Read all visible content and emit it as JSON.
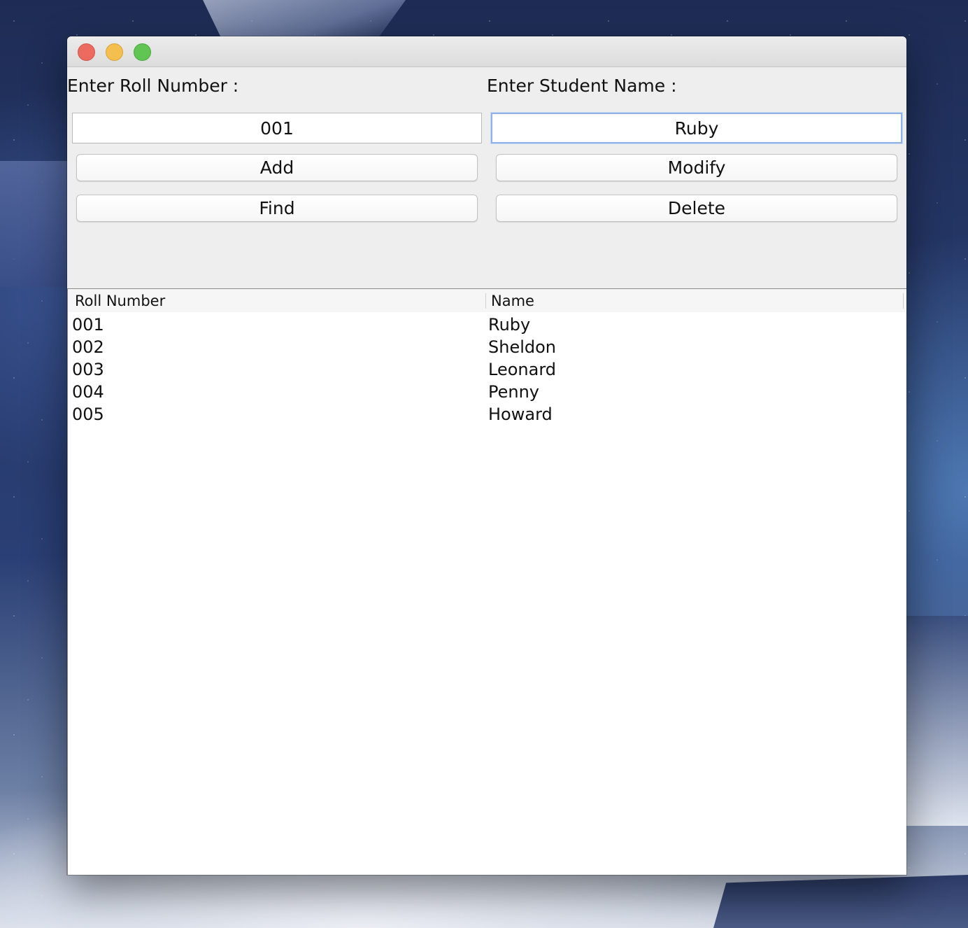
{
  "form": {
    "roll_label": "Enter Roll Number :",
    "name_label": "Enter Student Name :",
    "roll_value": "001",
    "name_value": "Ruby"
  },
  "buttons": {
    "add": "Add",
    "modify": "Modify",
    "find": "Find",
    "delete": "Delete"
  },
  "table": {
    "columns": [
      "Roll Number",
      "Name"
    ],
    "rows": [
      [
        "001",
        "Ruby"
      ],
      [
        "002",
        "Sheldon"
      ],
      [
        "003",
        "Leonard"
      ],
      [
        "004",
        "Penny"
      ],
      [
        "005",
        "Howard"
      ]
    ]
  },
  "colors": {
    "close": "#ec6a5f",
    "minimize": "#f5bf4f",
    "maximize": "#61c554",
    "focus_ring": "#8fb3e6"
  }
}
